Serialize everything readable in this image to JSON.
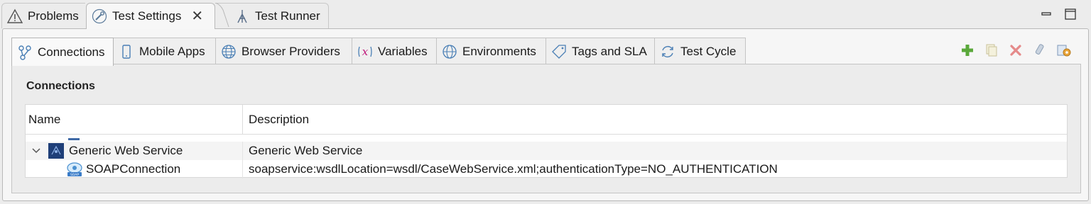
{
  "view_tabs": [
    {
      "label": "Problems",
      "icon": "warning-icon"
    },
    {
      "label": "Test Settings",
      "icon": "wrench-icon",
      "active": true
    },
    {
      "label": "Test Runner",
      "icon": "test-runner-icon"
    }
  ],
  "inner_tabs": [
    {
      "label": "Connections",
      "icon": "connections-icon",
      "active": true
    },
    {
      "label": "Mobile Apps",
      "icon": "mobile-icon"
    },
    {
      "label": "Browser Providers",
      "icon": "globe-icon"
    },
    {
      "label": "Variables",
      "icon": "variable-x-icon"
    },
    {
      "label": "Environments",
      "icon": "globe-icon"
    },
    {
      "label": "Tags and SLA",
      "icon": "tag-icon"
    },
    {
      "label": "Test Cycle",
      "icon": "cycle-icon"
    }
  ],
  "toolbar": [
    "add-icon",
    "copy-icon",
    "delete-icon",
    "test-connection-icon",
    "configure-icon"
  ],
  "section_title": "Connections",
  "table": {
    "columns": [
      "Name",
      "Description"
    ],
    "rows": [
      {
        "name": "Generic Web Service",
        "description": "Generic Web Service",
        "expanded": true,
        "level": 0
      },
      {
        "name": "SOAPConnection",
        "description": "soapservice:wsdlLocation=wsdl/CaseWebService.xml;authenticationType=NO_AUTHENTICATION",
        "level": 1
      }
    ]
  },
  "colors": {
    "accent_green": "#4caf3d",
    "delete_red": "#e05a5a",
    "link_blue": "#3a78c8"
  }
}
